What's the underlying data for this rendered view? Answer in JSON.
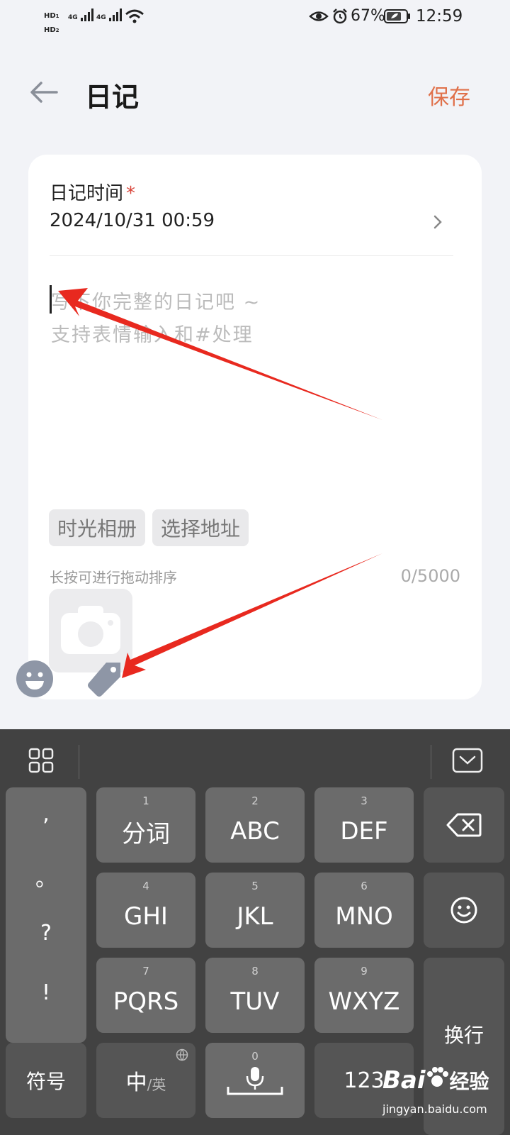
{
  "status": {
    "sim1": "HD",
    "sim1_idx": "1",
    "sim2": "HD",
    "sim2_idx": "2",
    "net1": "4G",
    "net2": "4G",
    "battery": "67%",
    "time": "12:59"
  },
  "header": {
    "title": "日记",
    "save_label": "保存"
  },
  "form": {
    "time_label": "日记时间",
    "required_mark": "*",
    "time_value": "2024/10/31 00:59",
    "placeholder_line1": "写下你完整的日记吧 ~",
    "placeholder_line2": "支持表情输入和#处理",
    "chips": [
      "时光相册",
      "选择地址"
    ],
    "hint": "长按可进行拖动排序",
    "counter": "0/5000"
  },
  "keyboard": {
    "punct": [
      ",",
      "。",
      "?",
      "!"
    ],
    "keys": [
      {
        "num": "1",
        "label": "分词"
      },
      {
        "num": "2",
        "label": "ABC"
      },
      {
        "num": "3",
        "label": "DEF"
      },
      {
        "num": "4",
        "label": "GHI"
      },
      {
        "num": "5",
        "label": "JKL"
      },
      {
        "num": "6",
        "label": "MNO"
      },
      {
        "num": "7",
        "label": "PQRS"
      },
      {
        "num": "8",
        "label": "TUV"
      },
      {
        "num": "9",
        "label": "WXYZ"
      }
    ],
    "symbols": "符号",
    "lang_main": "中",
    "lang_alt": "/英",
    "space_num": "0",
    "num_mode": "123",
    "enter": "换行"
  },
  "watermark": {
    "brand": "Bai",
    "brand2": "经验",
    "url": "jingyan.baidu.com"
  },
  "colors": {
    "accent": "#e0704a",
    "arrow": "#e8291f"
  }
}
